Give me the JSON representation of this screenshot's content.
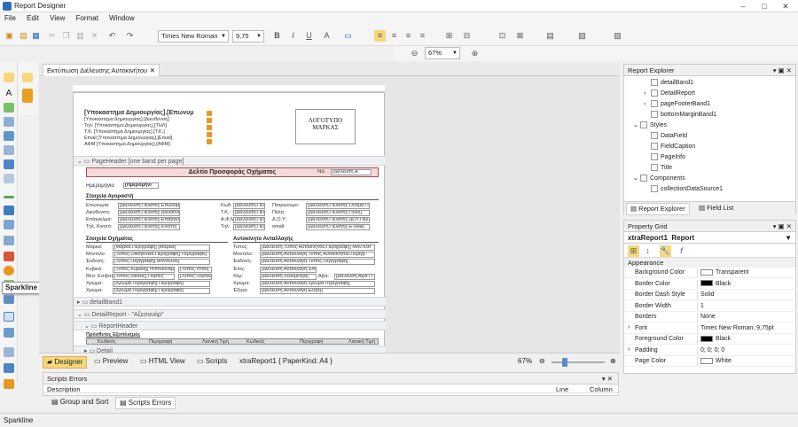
{
  "app": {
    "title": "Report Designer"
  },
  "menu": [
    "File",
    "Edit",
    "View",
    "Format",
    "Window"
  ],
  "toolbar": {
    "font": "Times New Roman",
    "size": "9,75",
    "zoom": "67%"
  },
  "document_tab": "Εκτύπωση Διέλευσης Αυτοκινήτου",
  "tooltip": "Sparkline",
  "report": {
    "header_left": "[Υποκαστημα Δημιουργίας].[Επωνυμ",
    "header_rows": [
      "[Υποκαστημα Δημιουργίας].[Διευθύνση]",
      "Τηλ:  [Υποκαστημα Δημιουργίας].[ΤΗΛ]",
      "Τ.Κ.  [Υποκαστημα Δημιουργίας].[Τ.Κ.]",
      "Email  [Υποκαστημα Δημιουργίας].[Email]",
      "ΑΦΜ  [Υποκαστημα Δημιουργίας].[ΑΦΜ]"
    ],
    "logo_line1": "ΛΟΓΟΤΥΠΟ",
    "logo_line2": "ΜΑΡΚΑΣ",
    "band_pageheader": "PageHeader [one band per page]",
    "doc_title": "Δελτίο Προσφοράς Οχήματος",
    "no_label": "Νο:",
    "no_field": "[Διέλευση.Α",
    "date_label": "Ημερομηνία",
    "date_field": "[Ημερομηνί",
    "buyer_section": "Στοιχεία Αγοραστή",
    "buyer_rows": [
      [
        "Επωνυμία:",
        "[Διέλευση.Πελάτης.Επωνυμία]",
        "Κωδ:",
        "[Διέλευση.Πελάτη",
        "Πατρώνυμο:",
        "[Διέλευση.Πελάτης.Όνομα Π"
      ],
      [
        "Διεύθυνση:",
        "[Διέλευση.Πελάτης.Διεύθυνση]",
        "Τ.Κ.:",
        "[Διέλευση.Πελάτη",
        "Πόλη:",
        "[Διέλευση.Πελάτης.Πόλη]"
      ],
      [
        "Επάγγελμα:",
        "[Διέλευση.Πελάτης.Επάγγελμα]",
        "Α.Φ.Μ.:",
        "[Διέλευση.Πελάτη",
        "Δ.Ο.Υ.:",
        "[Διέλευση.Πελάτης.ΔΟΥ.Περ"
      ],
      [
        "Τηλ. Κινητό:",
        "[Διέλευση.Πελάτης.Κινητό]",
        "Τηλ:",
        "[Διέλευση.Πελάτη",
        "email:",
        "[Διέλευση.Πελάτης.E-Mail]"
      ]
    ],
    "vehicle_section": "Στοιχεία Οχήματος",
    "trade_section": "Αυτοκίνητο Ανταλλαγής",
    "vehicle_rows": [
      [
        "Μάρκα:",
        "[Μάρκα.Περιγραφή] [Μάρκα]",
        "Τύπος:",
        "[Διέλευση.Τύπος Αυτοκινήτου.Περιγραφή] Μον.Κατ"
      ],
      [
        "Μοντέλο:",
        "[Τύπος.Οικογένεια.Περιγραφή] Περιγράφει]",
        "Μοντέλο:",
        "[Διέλευση.Ανταλλαγή.Τύπος Αυτοκινήτου.Περιγρ"
      ],
      [
        "Έκδοση:",
        "[Τύπος.Περιγραφή] Μοντέλου]",
        "Έκδοση:",
        "[Διέλευση.Ανταλλαγή.Τύπος.Περιγραφή]"
      ],
      [
        "Κυβικά:",
        "[Τύπος.Κυβικά]] Ιπποδύναμη:",
        "[Τύπος.Ίππο]",
        "Έτος:",
        "[Διέλευση.Ανταλλαγή.Έτος Κατασκευής]"
      ],
      [
        "Θέσ. Επιβατ.:",
        "[Τύπος.Θέσεις] Πόρτες:",
        "[Τύπος.Πόρτες]",
        "Χλμ:",
        "[Διέλευση.Χιλιόμετρα]",
        "Αξία:",
        "[Διέλευση.Αξία Π"
      ],
      [
        "Χρώμα:",
        "[Χρώμα.Περιγραφή] Περιγραφή]",
        "Χρώμα:",
        "[Διέλευση.Ανταλλαγή.Χρώμα.Περιγραφή]"
      ],
      [
        "Χρώμα:",
        "[Χρώμα.Περιγραφή] Περιγραφή]",
        "Έξτρα:",
        "[Διέλευση.Ανταλλαγή.Εξτρα]"
      ]
    ],
    "band_detail1": "detailBand1",
    "band_detailreport": "DetailReport - \"Αξεσουάρ\"",
    "band_reportheader": "ReportHeader",
    "extras_section": "Πρόσθετος Εξοπλισμός",
    "extras_cols": [
      "Κωδικός",
      "Περιγραφή",
      "Λιανική Τιμή",
      "Κωδικός",
      "Περιγραφή",
      "Λιανική Τιμή"
    ],
    "band_detail": "Detail"
  },
  "bottom_tabs": {
    "designer": "Designer",
    "preview": "Preview",
    "html": "HTML View",
    "scripts": "Scripts",
    "report_name": "xtraReport1 { PaperKind: A4 }",
    "zoom": "67%"
  },
  "errors": {
    "title": "Scripts Errors",
    "col_desc": "Description",
    "col_line": "Line",
    "col_column": "Column",
    "tab1": "Group and Sort",
    "tab2": "Scripts Errors"
  },
  "explorer": {
    "title": "Report Explorer",
    "items": [
      "detailBand1",
      "DetailReport",
      "pageFooterBand1",
      "bottomMarginBand1",
      "Styles",
      "DataField",
      "FieldCaption",
      "PageInfo",
      "Title",
      "Components",
      "collectionDataSource1"
    ],
    "tab1": "Report Explorer",
    "tab2": "Field List"
  },
  "propgrid": {
    "title": "Property Grid",
    "object": "xtraReport1",
    "object_type": "Report",
    "category": "Appearance",
    "rows": [
      [
        "Background Color",
        "Transparent"
      ],
      [
        "Border Color",
        "Black"
      ],
      [
        "Border Dash Style",
        "Solid"
      ],
      [
        "Border Width",
        "1"
      ],
      [
        "Borders",
        "None"
      ],
      [
        "Font",
        "Times New Roman; 9,75pt"
      ],
      [
        "Foreground Color",
        "Black"
      ],
      [
        "Padding",
        "0; 0; 0; 0"
      ],
      [
        "Page Color",
        "White"
      ]
    ]
  },
  "status": "Sparkline"
}
